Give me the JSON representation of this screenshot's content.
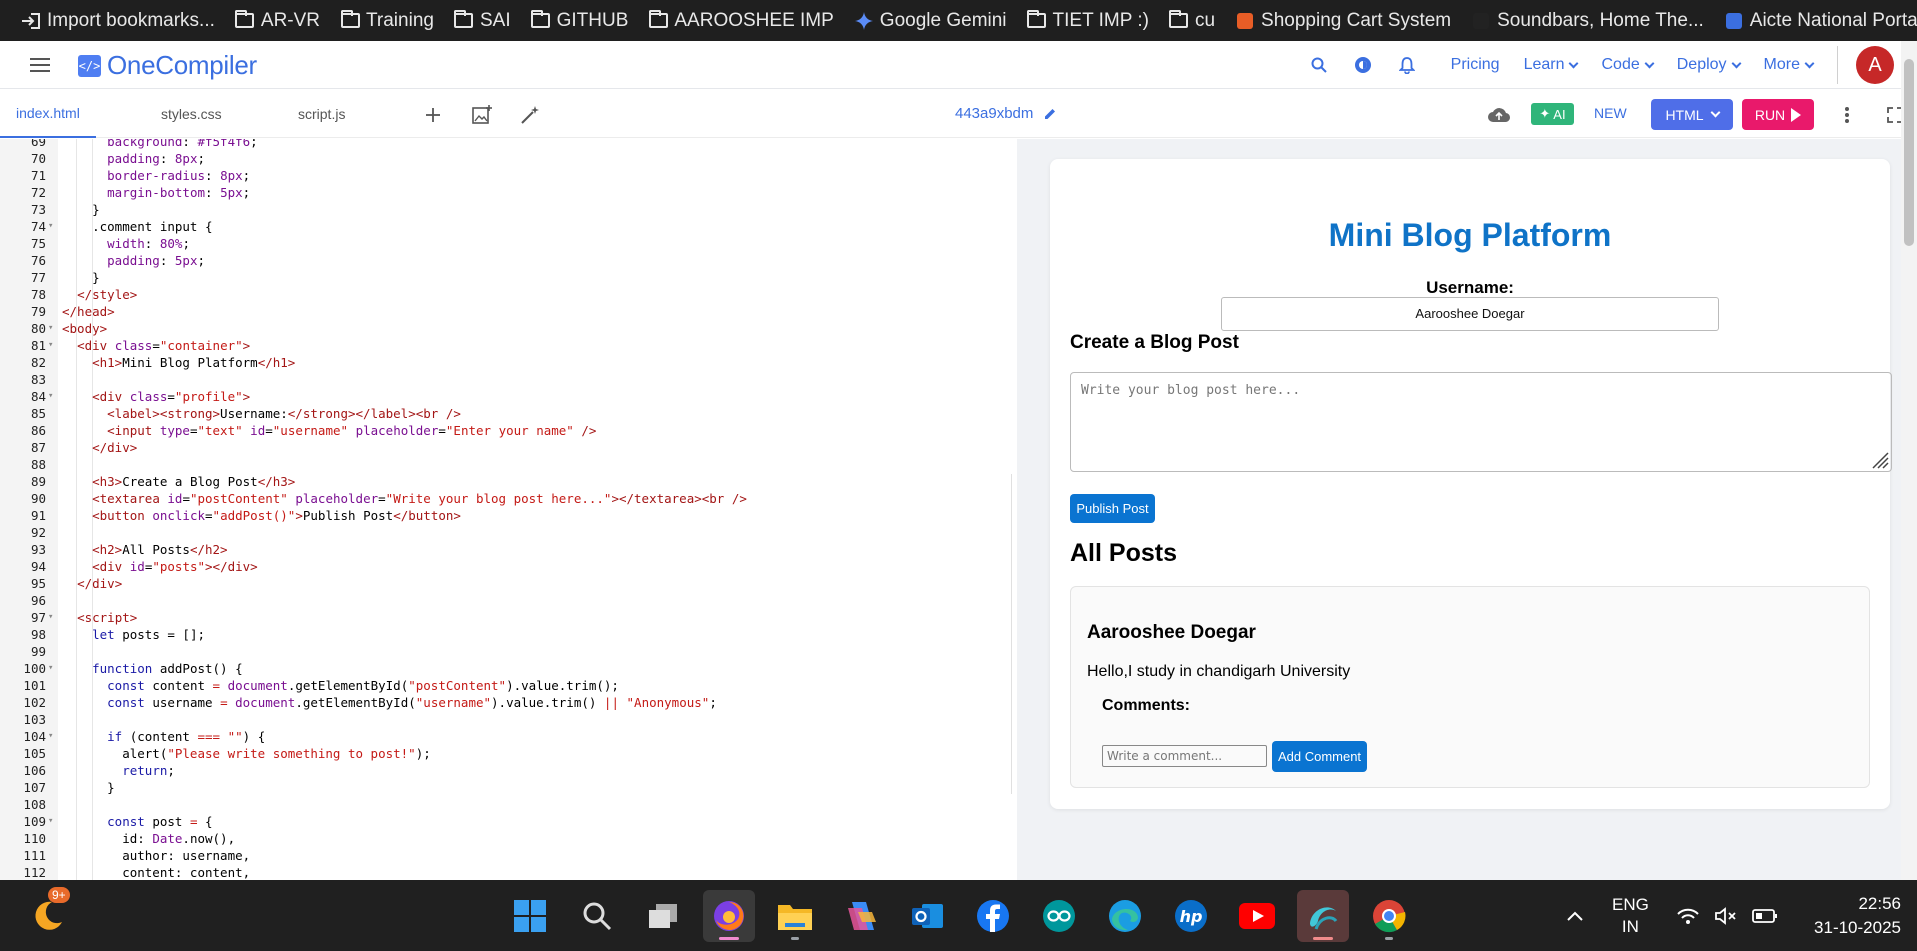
{
  "bookmarks": [
    {
      "label": "Import bookmarks...",
      "icon": "import-icon"
    },
    {
      "label": "AR-VR",
      "icon": "folder-icon"
    },
    {
      "label": "Training",
      "icon": "folder-icon"
    },
    {
      "label": "SAI",
      "icon": "folder-icon"
    },
    {
      "label": "GITHUB",
      "icon": "folder-icon"
    },
    {
      "label": "AAROOSHEE IMP",
      "icon": "folder-icon"
    },
    {
      "label": "Google Gemini",
      "icon": "gemini-icon"
    },
    {
      "label": "TIET IMP :)",
      "icon": "folder-icon"
    },
    {
      "label": "cu",
      "icon": "folder-icon"
    },
    {
      "label": "Shopping Cart System",
      "icon": "site-icon"
    },
    {
      "label": "Soundbars, Home The...",
      "icon": "site-icon"
    },
    {
      "label": "Aicte National Portal -...",
      "icon": "site-icon"
    }
  ],
  "header": {
    "logo": "OneCompiler",
    "logo_mark": "</>",
    "nav": [
      "Pricing",
      "Learn",
      "Code",
      "Deploy",
      "More"
    ],
    "avatar": "A"
  },
  "toolbar": {
    "tabs": [
      "index.html",
      "styles.css",
      "script.js"
    ],
    "active_tab": "index.html",
    "file_id": "443a9xbdm",
    "ai_label": "AI",
    "new_label": "NEW",
    "language": "HTML",
    "run_label": "RUN"
  },
  "editor": {
    "lines": [
      {
        "n": "69",
        "fold": "",
        "html": "      <span class=\"prop\">background</span>: <span class=\"num\">#f5f4f6</span>;"
      },
      {
        "n": "70",
        "fold": "",
        "html": "      <span class=\"prop\">padding</span>: <span class=\"num\">8px</span>;"
      },
      {
        "n": "71",
        "fold": "",
        "html": "      <span class=\"prop\">border-radius</span>: <span class=\"num\">8px</span>;"
      },
      {
        "n": "72",
        "fold": "",
        "html": "      <span class=\"prop\">margin-bottom</span>: <span class=\"num\">5px</span>;"
      },
      {
        "n": "73",
        "fold": "",
        "html": "    }"
      },
      {
        "n": "74",
        "fold": "▾",
        "html": "    .comment input {"
      },
      {
        "n": "75",
        "fold": "",
        "html": "      <span class=\"prop\">width</span>: <span class=\"num\">80%</span>;"
      },
      {
        "n": "76",
        "fold": "",
        "html": "      <span class=\"prop\">padding</span>: <span class=\"num\">5px</span>;"
      },
      {
        "n": "77",
        "fold": "",
        "html": "    }"
      },
      {
        "n": "78",
        "fold": "",
        "html": "  <span class=\"tag\">&lt;/style&gt;</span>"
      },
      {
        "n": "79",
        "fold": "",
        "html": "<span class=\"tag\">&lt;/head&gt;</span>"
      },
      {
        "n": "80",
        "fold": "▾",
        "html": "<span class=\"tag\">&lt;body&gt;</span>"
      },
      {
        "n": "81",
        "fold": "▾",
        "html": "  <span class=\"tag\">&lt;div</span> <span class=\"attr\">class</span>=<span class=\"str\">\"container\"</span><span class=\"tag\">&gt;</span>"
      },
      {
        "n": "82",
        "fold": "",
        "html": "    <span class=\"tag\">&lt;h1&gt;</span>Mini Blog Platform<span class=\"tag\">&lt;/h1&gt;</span>"
      },
      {
        "n": "83",
        "fold": "",
        "html": ""
      },
      {
        "n": "84",
        "fold": "▾",
        "html": "    <span class=\"tag\">&lt;div</span> <span class=\"attr\">class</span>=<span class=\"str\">\"profile\"</span><span class=\"tag\">&gt;</span>"
      },
      {
        "n": "85",
        "fold": "",
        "html": "      <span class=\"tag\">&lt;label&gt;&lt;strong&gt;</span>Username:<span class=\"tag\">&lt;/strong&gt;&lt;/label&gt;&lt;br /&gt;</span>"
      },
      {
        "n": "86",
        "fold": "",
        "html": "      <span class=\"tag\">&lt;input</span> <span class=\"attr\">type</span>=<span class=\"str\">\"text\"</span> <span class=\"attr\">id</span>=<span class=\"str\">\"username\"</span> <span class=\"attr\">placeholder</span>=<span class=\"str\">\"Enter your name\"</span> <span class=\"tag\">/&gt;</span>"
      },
      {
        "n": "87",
        "fold": "",
        "html": "    <span class=\"tag\">&lt;/div&gt;</span>"
      },
      {
        "n": "88",
        "fold": "",
        "html": ""
      },
      {
        "n": "89",
        "fold": "",
        "html": "    <span class=\"tag\">&lt;h3&gt;</span>Create a Blog Post<span class=\"tag\">&lt;/h3&gt;</span>"
      },
      {
        "n": "90",
        "fold": "",
        "html": "    <span class=\"tag\">&lt;textarea</span> <span class=\"attr\">id</span>=<span class=\"str\">\"postContent\"</span> <span class=\"attr\">placeholder</span>=<span class=\"str\">\"Write your blog post here...\"</span><span class=\"tag\">&gt;&lt;/textarea&gt;&lt;br /&gt;</span>"
      },
      {
        "n": "91",
        "fold": "",
        "html": "    <span class=\"tag\">&lt;button</span> <span class=\"attr\">onclick</span>=<span class=\"str\">\"addPost()\"</span><span class=\"tag\">&gt;</span>Publish Post<span class=\"tag\">&lt;/button&gt;</span>"
      },
      {
        "n": "92",
        "fold": "",
        "html": ""
      },
      {
        "n": "93",
        "fold": "",
        "html": "    <span class=\"tag\">&lt;h2&gt;</span>All Posts<span class=\"tag\">&lt;/h2&gt;</span>"
      },
      {
        "n": "94",
        "fold": "",
        "html": "    <span class=\"tag\">&lt;div</span> <span class=\"attr\">id</span>=<span class=\"str\">\"posts\"</span><span class=\"tag\">&gt;&lt;/div&gt;</span>"
      },
      {
        "n": "95",
        "fold": "",
        "html": "  <span class=\"tag\">&lt;/div&gt;</span>"
      },
      {
        "n": "96",
        "fold": "",
        "html": ""
      },
      {
        "n": "97",
        "fold": "▾",
        "html": "  <span class=\"tag\">&lt;script&gt;</span>"
      },
      {
        "n": "98",
        "fold": "",
        "html": "    <span class=\"kw\">let</span> posts = [];"
      },
      {
        "n": "99",
        "fold": "",
        "html": ""
      },
      {
        "n": "100",
        "fold": "▾",
        "html": "    <span class=\"kw\">function</span> addPost() {"
      },
      {
        "n": "101",
        "fold": "",
        "html": "      <span class=\"kw\">const</span> content <span class=\"str\">=</span> <span class=\"attr\">document</span>.getElementById(<span class=\"str\">\"postContent\"</span>).value.trim();"
      },
      {
        "n": "102",
        "fold": "",
        "html": "      <span class=\"kw\">const</span> username <span class=\"str\">=</span> <span class=\"attr\">document</span>.getElementById(<span class=\"str\">\"username\"</span>).value.trim() <span class=\"str\">||</span> <span class=\"str\">\"Anonymous\"</span>;"
      },
      {
        "n": "103",
        "fold": "",
        "html": ""
      },
      {
        "n": "104",
        "fold": "▾",
        "html": "      <span class=\"kw\">if</span> (content <span class=\"str\">===</span> <span class=\"str\">\"\"</span>) {"
      },
      {
        "n": "105",
        "fold": "",
        "html": "        alert(<span class=\"str\">\"Please write something to post!\"</span>);"
      },
      {
        "n": "106",
        "fold": "",
        "html": "        <span class=\"kw\">return</span>;"
      },
      {
        "n": "107",
        "fold": "",
        "html": "      }"
      },
      {
        "n": "108",
        "fold": "",
        "html": ""
      },
      {
        "n": "109",
        "fold": "▾",
        "html": "      <span class=\"kw\">const</span> post <span class=\"str\">=</span> {"
      },
      {
        "n": "110",
        "fold": "",
        "html": "        id: <span class=\"attr\">Date</span>.now(),"
      },
      {
        "n": "111",
        "fold": "",
        "html": "        author: username,"
      },
      {
        "n": "112",
        "fold": "",
        "html": "        content: content,"
      }
    ]
  },
  "preview": {
    "title": "Mini Blog Platform",
    "username_label": "Username:",
    "username_value": "Aarooshee Doegar",
    "create_heading": "Create a Blog Post",
    "textarea_placeholder": "Write your blog post here...",
    "publish_label": "Publish Post",
    "all_posts_heading": "All Posts",
    "post": {
      "author": "Aarooshee Doegar",
      "content": "Hello,I study in chandigarh University",
      "comments_label": "Comments:",
      "comment_placeholder": "Write a comment...",
      "add_comment_label": "Add Comment"
    }
  },
  "taskbar": {
    "notification_badge": "9+",
    "apps": [
      "windows-start-icon",
      "search-icon",
      "task-view-icon",
      "firefox-icon",
      "file-explorer-icon",
      "copilot-icon",
      "outlook-icon",
      "facebook-icon",
      "arduino-icon",
      "edge-icon",
      "hp-icon",
      "youtube-icon",
      "app-icon",
      "chrome-icon"
    ],
    "lang_line1": "ENG",
    "lang_line2": "IN",
    "time": "22:56",
    "date": "31-10-2025"
  },
  "colors": {
    "brand": "#3b6fe0",
    "run": "#e9196b",
    "ai": "#2fb57a",
    "preview_accent": "#0a74d1"
  }
}
